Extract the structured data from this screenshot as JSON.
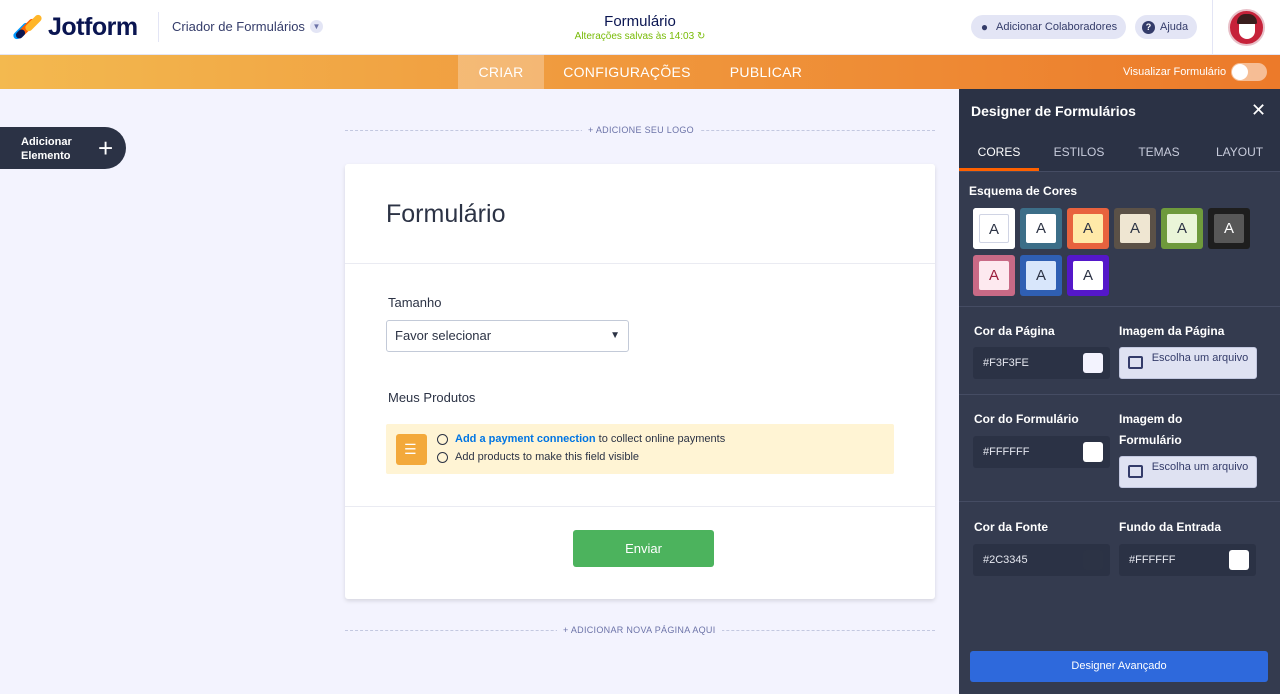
{
  "brand": {
    "name": "Jotform"
  },
  "header": {
    "builder_label": "Criador de Formulários",
    "form_title": "Formulário",
    "saved_status": "Alterações salvas às 14:03",
    "collaborators_label": "Adicionar Colaboradores",
    "help_label": "Ajuda"
  },
  "nav": {
    "tabs": [
      {
        "label": "CRIAR",
        "active": true
      },
      {
        "label": "CONFIGURAÇÕES",
        "active": false
      },
      {
        "label": "PUBLICAR",
        "active": false
      }
    ],
    "preview_label": "Visualizar Formulário"
  },
  "left": {
    "add_element_label": "Adicionar Elemento",
    "add_symbol": "+"
  },
  "canvas": {
    "add_logo": "+ ADICIONE SEU LOGO",
    "add_page": "+ ADICIONAR NOVA PÁGINA AQUI",
    "form": {
      "title": "Formulário",
      "size_label": "Tamanho",
      "size_placeholder": "Favor selecionar",
      "products_label": "Meus Produtos",
      "payment_link": "Add a payment connection",
      "payment_text": " to collect online payments",
      "products_text": "Add products to make this field visible",
      "submit_label": "Enviar"
    }
  },
  "panel": {
    "title": "Designer de Formulários",
    "tabs": [
      {
        "label": "CORES",
        "active": true
      },
      {
        "label": "ESTILOS",
        "active": false
      },
      {
        "label": "TEMAS",
        "active": false
      },
      {
        "label": "LAYOUT",
        "active": false
      }
    ],
    "scheme_label": "Esquema de Cores",
    "schemes": [
      {
        "letter": "A",
        "outer": "#ffffff",
        "inner": "#ffffff",
        "text": "#2c3345",
        "selected": true
      },
      {
        "letter": "A",
        "outer": "#3c6e88",
        "inner": "#ffffff",
        "text": "#2c3345"
      },
      {
        "letter": "A",
        "outer": "#e8623e",
        "inner": "#ffe9a8",
        "text": "#2c3345"
      },
      {
        "letter": "A",
        "outer": "#5b5147",
        "inner": "#efe6d2",
        "text": "#2c3345"
      },
      {
        "letter": "A",
        "outer": "#6e9a3c",
        "inner": "#eaf5d8",
        "text": "#2c3345"
      },
      {
        "letter": "A",
        "outer": "#1e1e1e",
        "inner": "#575757",
        "text": "#ffffff"
      },
      {
        "letter": "A",
        "outer": "#c96a86",
        "inner": "#fde9ef",
        "text": "#9b1d3c"
      },
      {
        "letter": "A",
        "outer": "#2f5fb3",
        "inner": "#d8e6fb",
        "text": "#2c3345"
      },
      {
        "letter": "A",
        "outer": "#5417c9",
        "inner": "#ffffff",
        "text": "#2c3345"
      }
    ],
    "page_color_label": "Cor da Página",
    "page_color_value": "#F3F3FE",
    "page_image_label": "Imagem da Página",
    "form_color_label": "Cor do Formulário",
    "form_color_value": "#FFFFFF",
    "form_image_label": "Imagem do Formulário",
    "font_color_label": "Cor da Fonte",
    "font_color_value": "#2C3345",
    "input_bg_label": "Fundo da Entrada",
    "input_bg_value": "#FFFFFF",
    "choose_file_label": "Escolha um arquivo",
    "advanced_label": "Designer Avançado"
  },
  "colors": {
    "accent_orange": "#ff6100",
    "submit_green": "#4cb35d",
    "advanced_blue": "#2e69dc",
    "panel_bg": "#343b4f"
  }
}
